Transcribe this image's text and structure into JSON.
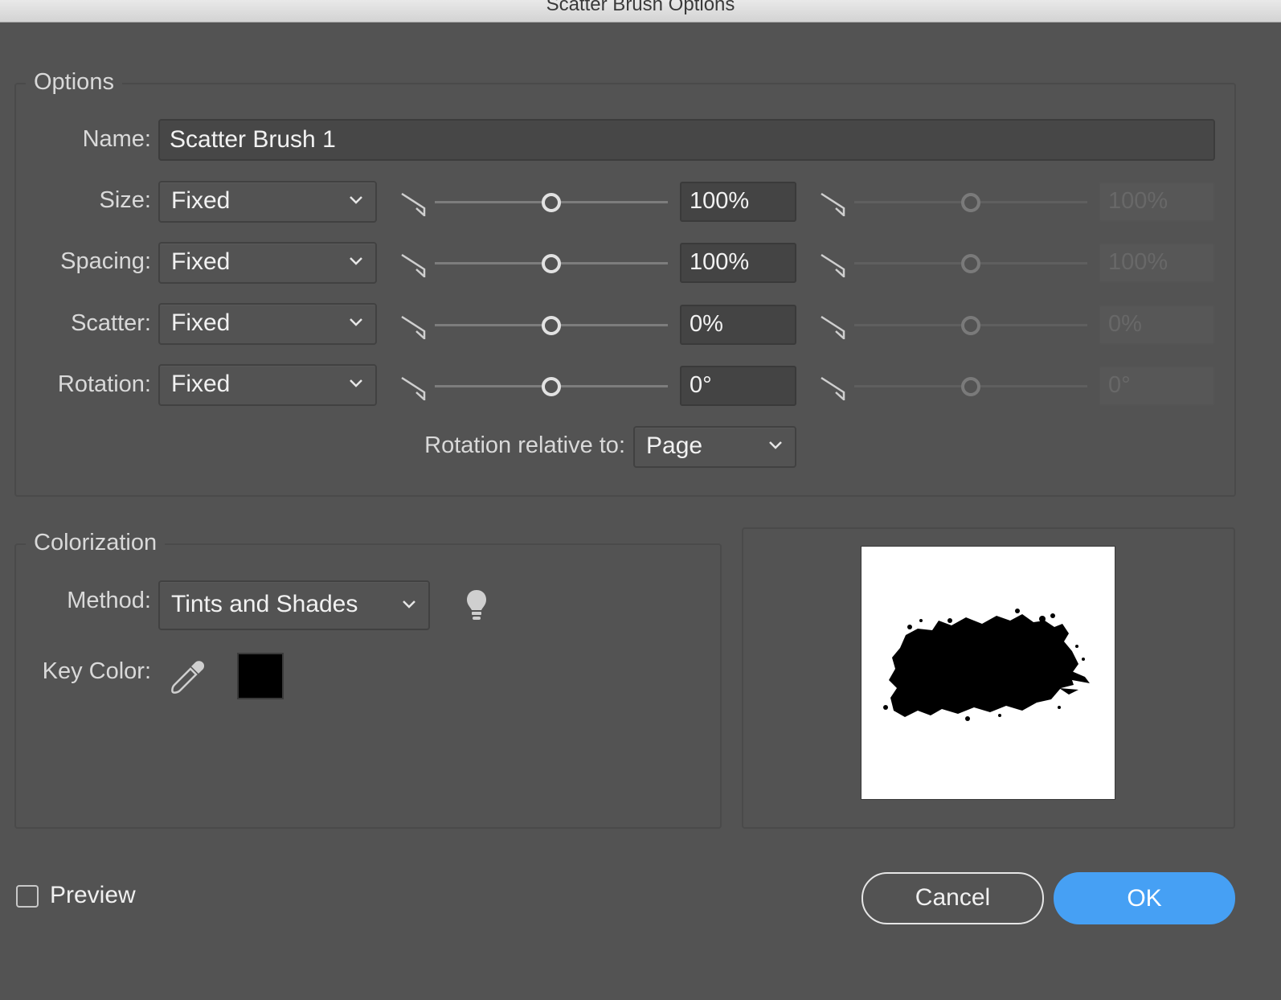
{
  "window": {
    "title": "Scatter Brush Options"
  },
  "options_group": {
    "legend": "Options",
    "name_label": "Name:",
    "name_value": "Scatter Brush 1",
    "rows": [
      {
        "label": "Size:",
        "method": "Fixed",
        "min_value": "100%",
        "max_value": "100%"
      },
      {
        "label": "Spacing:",
        "method": "Fixed",
        "min_value": "100%",
        "max_value": "100%"
      },
      {
        "label": "Scatter:",
        "method": "Fixed",
        "min_value": "0%",
        "max_value": "0%"
      },
      {
        "label": "Rotation:",
        "method": "Fixed",
        "min_value": "0°",
        "max_value": "0°"
      }
    ],
    "rotation_relative_label": "Rotation relative to:",
    "rotation_relative_value": "Page"
  },
  "colorization_group": {
    "legend": "Colorization",
    "method_label": "Method:",
    "method_value": "Tints and Shades",
    "key_color_label": "Key Color:",
    "key_color": "#000000"
  },
  "footer": {
    "preview_label": "Preview",
    "preview_checked": false,
    "cancel_label": "Cancel",
    "ok_label": "OK"
  },
  "colors": {
    "accent": "#46a0f4",
    "background": "#535353"
  },
  "icons": [
    "slider-icon",
    "chevron-down-icon",
    "tip-lightbulb-icon",
    "eyedropper-icon",
    "checkbox-icon"
  ]
}
